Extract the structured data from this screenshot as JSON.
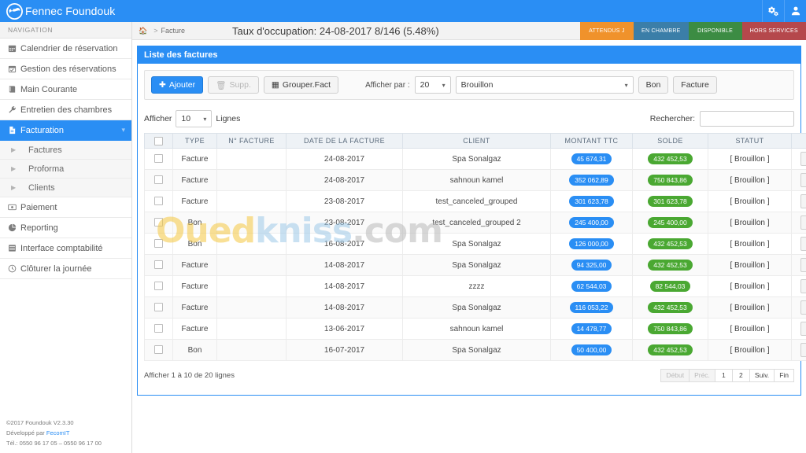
{
  "app": {
    "brand": "Fennec Foundouk",
    "logo_icon": "globe-logo-icon",
    "settings_icon": "gears-icon",
    "user_icon": "user-icon"
  },
  "sidebar": {
    "header": "NAVIGATION",
    "items": [
      {
        "label": "Calendrier de réservation",
        "icon": "calendar-icon",
        "active": false,
        "type": "item"
      },
      {
        "label": "Gestion des réservations",
        "icon": "calendar-check-icon",
        "active": false,
        "type": "item"
      },
      {
        "label": "Main Courante",
        "icon": "book-icon",
        "active": false,
        "type": "item"
      },
      {
        "label": "Entretien des chambres",
        "icon": "wrench-icon",
        "active": false,
        "type": "item"
      },
      {
        "label": "Facturation",
        "icon": "file-invoice-icon",
        "active": true,
        "type": "item"
      },
      {
        "label": "Factures",
        "icon": "caret-right-icon",
        "active": false,
        "type": "sub"
      },
      {
        "label": "Proforma",
        "icon": "caret-right-icon",
        "active": false,
        "type": "sub"
      },
      {
        "label": "Clients",
        "icon": "caret-right-icon",
        "active": false,
        "type": "sub"
      },
      {
        "label": "Paiement",
        "icon": "money-icon",
        "active": false,
        "type": "item"
      },
      {
        "label": "Reporting",
        "icon": "pie-chart-icon",
        "active": false,
        "type": "item"
      },
      {
        "label": "Interface comptabilité",
        "icon": "ledger-icon",
        "active": false,
        "type": "item"
      },
      {
        "label": "Clôturer la journée",
        "icon": "clock-icon",
        "active": false,
        "type": "item"
      }
    ],
    "credits": {
      "copyright": "©2017 Foundouk V2.3.30",
      "developed_prefix": "Développé par ",
      "developer": "FecomIT",
      "phone": "Tél.: 0550 96 17 05 – 0550 96 17 00"
    }
  },
  "breadcrumb": {
    "home_icon": "home-icon",
    "separator": ">",
    "current": "Facture"
  },
  "occupancy": {
    "text": "Taux d'occupation: 24-08-2017  8/146 (5.48%)"
  },
  "legend": [
    {
      "label": "ATTENDUS J",
      "color": "#f0922b"
    },
    {
      "label": "EN CHAMBRE",
      "color": "#3b7ea8"
    },
    {
      "label": "DISPONIBLE",
      "color": "#3c8c43"
    },
    {
      "label": "HORS SERVICES",
      "color": "#b5484c"
    }
  ],
  "panel": {
    "title": "Liste des factures"
  },
  "toolbar": {
    "add_label": "Ajouter",
    "add_icon": "plus-icon",
    "delete_label": "Supp.",
    "delete_icon": "trash-icon",
    "group_label": "Grouper.Fact",
    "group_icon": "table-icon",
    "display_by_label": "Afficher par :",
    "page_size_value": "20",
    "status_filter_value": "Brouillon",
    "bon_label": "Bon",
    "facture_label": "Facture",
    "caret_icon": "caret-down-icon"
  },
  "table_controls": {
    "afficher_label": "Afficher",
    "rows_value": "10",
    "lignes_label": "Lignes",
    "search_label": "Rechercher:",
    "search_value": "",
    "search_placeholder": ""
  },
  "table": {
    "columns": [
      "",
      "TYPE",
      "N° FACTURE",
      "DATE DE LA FACTURE",
      "CLIENT",
      "MONTANT TTC",
      "SOLDE",
      "STATUT",
      ""
    ],
    "rows": [
      {
        "type": "Facture",
        "num": "",
        "date": "24-08-2017",
        "client": "Spa Sonalgaz",
        "ttc": "45 674,31",
        "solde": "432 452,53",
        "statut": "[ Brouillon ]"
      },
      {
        "type": "Facture",
        "num": "",
        "date": "24-08-2017",
        "client": "sahnoun kamel",
        "ttc": "352 062,89",
        "solde": "750 843,86",
        "statut": "[ Brouillon ]"
      },
      {
        "type": "Facture",
        "num": "",
        "date": "23-08-2017",
        "client": "test_canceled_grouped",
        "ttc": "301 623,78",
        "solde": "301 623,78",
        "statut": "[ Brouillon ]"
      },
      {
        "type": "Bon",
        "num": "",
        "date": "23-08-2017",
        "client": "test_canceled_grouped 2",
        "ttc": "245 400,00",
        "solde": "245 400,00",
        "statut": "[ Brouillon ]"
      },
      {
        "type": "Bon",
        "num": "",
        "date": "16-08-2017",
        "client": "Spa Sonalgaz",
        "ttc": "126 000,00",
        "solde": "432 452,53",
        "statut": "[ Brouillon ]"
      },
      {
        "type": "Facture",
        "num": "",
        "date": "14-08-2017",
        "client": "Spa Sonalgaz",
        "ttc": "94 325,00",
        "solde": "432 452,53",
        "statut": "[ Brouillon ]"
      },
      {
        "type": "Facture",
        "num": "",
        "date": "14-08-2017",
        "client": "zzzz",
        "ttc": "62 544,03",
        "solde": "82 544,03",
        "statut": "[ Brouillon ]"
      },
      {
        "type": "Facture",
        "num": "",
        "date": "14-08-2017",
        "client": "Spa Sonalgaz",
        "ttc": "116 053,22",
        "solde": "432 452,53",
        "statut": "[ Brouillon ]"
      },
      {
        "type": "Facture",
        "num": "",
        "date": "13-06-2017",
        "client": "sahnoun kamel",
        "ttc": "14 478,77",
        "solde": "750 843,86",
        "statut": "[ Brouillon ]"
      },
      {
        "type": "Bon",
        "num": "",
        "date": "16-07-2017",
        "client": "Spa Sonalgaz",
        "ttc": "50 400,00",
        "solde": "432 452,53",
        "statut": "[ Brouillon ]"
      }
    ],
    "row_action_icon": "grid-icon",
    "row_action_caret": "caret-down-icon"
  },
  "pagination": {
    "info": "Afficher 1 à 10 de 20 lignes",
    "buttons": [
      {
        "label": "Début",
        "enabled": false
      },
      {
        "label": "Préc.",
        "enabled": false
      },
      {
        "label": "1",
        "enabled": true
      },
      {
        "label": "2",
        "enabled": true
      },
      {
        "label": "Suiv.",
        "enabled": true
      },
      {
        "label": "Fin",
        "enabled": true
      }
    ]
  },
  "watermark": {
    "part1": "Oued",
    "part2": "kniss",
    "part3": ".com"
  },
  "colors": {
    "accent": "#2a8ef4",
    "badge_ttc": "#2a8ef4",
    "badge_solde": "#4aa832"
  }
}
